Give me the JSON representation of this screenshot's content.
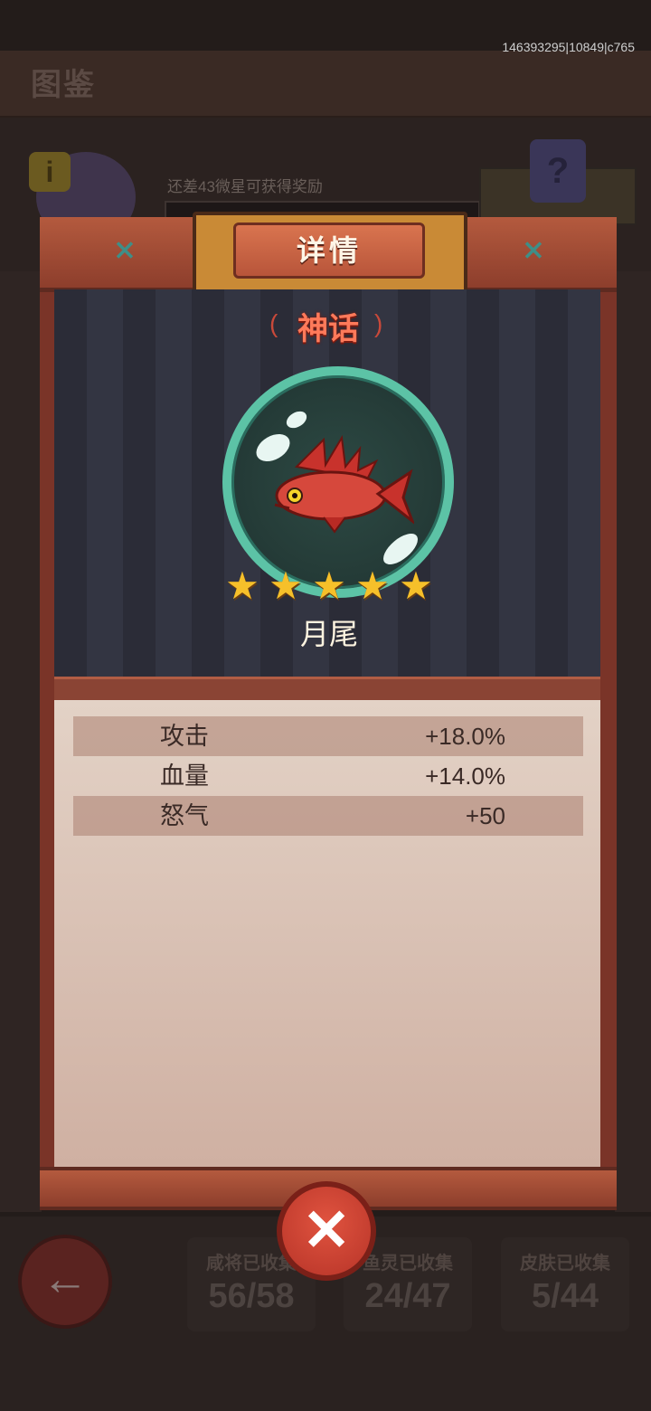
{
  "debug_id": "146393295|10849|c765",
  "background": {
    "page_title": "图鉴",
    "progress_text": "还差43微星可获得奖励",
    "info_icon": "info-icon",
    "help_icon": "question-mark-icon",
    "back_icon": "back-arrow-icon",
    "collections": [
      {
        "label": "咸将已收集",
        "value": "56/58"
      },
      {
        "label": "鱼灵已收集",
        "value": "24/47"
      },
      {
        "label": "皮肤已收集",
        "value": "5/44"
      }
    ]
  },
  "modal": {
    "title": "详情",
    "rarity": "神话",
    "fish_name": "月尾",
    "stars": 5,
    "stats": [
      {
        "name": "攻击",
        "value": "+18.0%"
      },
      {
        "name": "血量",
        "value": "+14.0%"
      },
      {
        "name": "怒气",
        "value": "+50"
      }
    ],
    "close_icon": "close-icon"
  },
  "colors": {
    "accent_wood": "#b45a3e",
    "rarity_red": "#ff7a5a",
    "orb_ring": "#5cc3a6",
    "star_gold": "#f6c02a"
  }
}
